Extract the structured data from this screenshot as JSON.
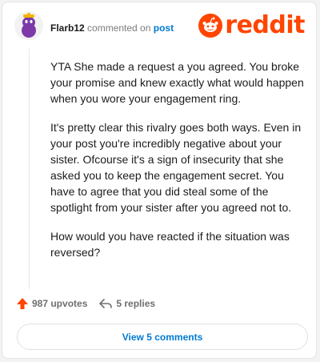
{
  "comment": {
    "username": "Flarb12",
    "action_text": "commented on",
    "target_link": "post",
    "paragraphs": [
      "YTA She made a request a you agreed. You broke your promise and knew exactly what would happen when you wore your engagement ring.",
      "It's pretty clear this rivalry goes both ways. Even in your post you're incredibly negative about your sister. Ofcourse it's a sign of insecurity that she asked you to keep the engagement secret. You have to agree that you did steal some of the spotlight from your sister after you agreed not to.",
      "How would you have reacted if the situation was reversed?"
    ],
    "upvotes_label": "987 upvotes",
    "replies_label": "5 replies"
  },
  "footer": {
    "view_comments_label": "View 5 comments"
  },
  "brand": {
    "wordmark": "reddit"
  },
  "icons": {
    "avatar": "snoo-avatar-icon",
    "logo": "reddit-alien-icon",
    "upvote": "upvote-arrow-icon",
    "reply": "reply-arrow-icon"
  },
  "colors": {
    "brand": "#ff4500",
    "link": "#0079d3",
    "text": "#1c1c1c",
    "muted": "#7c7c7c"
  }
}
